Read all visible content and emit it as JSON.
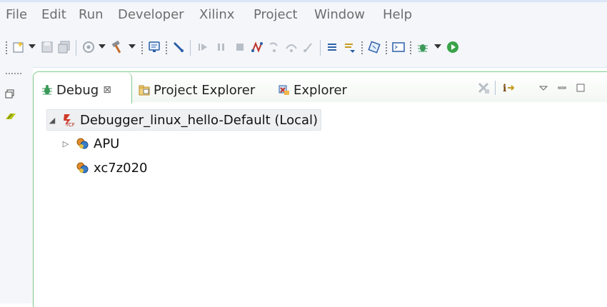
{
  "menubar": {
    "items": [
      "File",
      "Edit",
      "Run",
      "Developer",
      "Xilinx",
      "Project",
      "Window",
      "Help"
    ]
  },
  "toolbar": {
    "icons": [
      "new-icon",
      "save-icon",
      "save-all-icon",
      "target-icon",
      "build-hammer-icon",
      "console-icon",
      "disconnect-icon",
      "resume-icon",
      "suspend-icon",
      "terminate-icon",
      "connect-icon",
      "step-into-icon",
      "step-over-icon",
      "step-return-icon",
      "instruction-step-icon",
      "drop-to-frame-icon",
      "program-fpga-icon",
      "terminal-icon",
      "debug-icon",
      "run-icon"
    ]
  },
  "view": {
    "tabs": [
      {
        "label": "Debug",
        "icon": "debug-icon",
        "close": "⊠"
      },
      {
        "label": "Project Explorer",
        "icon": "project-explorer-icon"
      },
      {
        "label": "Explorer",
        "icon": "explorer-icon"
      }
    ]
  },
  "tree": {
    "nodes": [
      {
        "label": "Debugger_linux_hello-Default (Local)",
        "expanded": true,
        "twisty": "◢",
        "icon": "tcf-icon"
      },
      {
        "label": "APU",
        "expanded": false,
        "twisty": "▷",
        "icon": "processor-icon"
      },
      {
        "label": "xc7z020",
        "icon": "processor-icon"
      }
    ]
  },
  "colors": {
    "active_border": "#7fc98a",
    "menubar_bg": "#f4f6fa",
    "menu_text": "#6d6d6d"
  }
}
